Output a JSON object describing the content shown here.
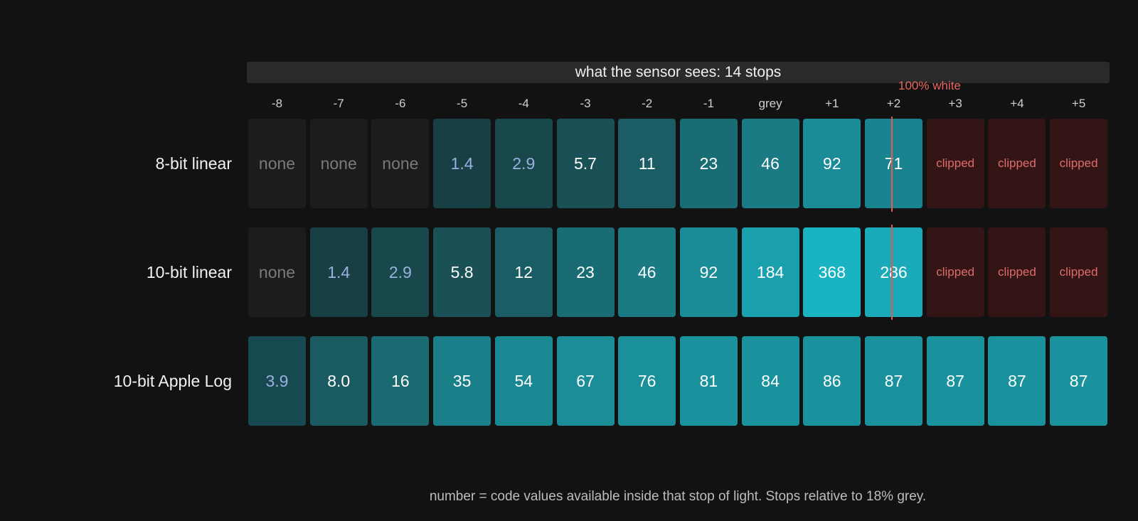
{
  "title": "what the sensor sees: 14 stops",
  "white_label": "100% white",
  "footnote": "number = code values available inside that stop of light. Stops relative to 18% grey.",
  "stops": [
    "-8",
    "-7",
    "-6",
    "-5",
    "-4",
    "-3",
    "-2",
    "-1",
    "grey",
    "+1",
    "+2",
    "+3",
    "+4",
    "+5"
  ],
  "rows": [
    {
      "label": "8-bit linear",
      "cells": [
        {
          "text": "none",
          "kind": "none"
        },
        {
          "text": "none",
          "kind": "none"
        },
        {
          "text": "none",
          "kind": "none"
        },
        {
          "text": "1.4",
          "kind": "dim",
          "color": "#173f44"
        },
        {
          "text": "2.9",
          "kind": "dim",
          "color": "#18474c"
        },
        {
          "text": "5.7",
          "kind": "val",
          "color": "#1a5157"
        },
        {
          "text": "11",
          "kind": "val",
          "color": "#1a5d64"
        },
        {
          "text": "23",
          "kind": "val",
          "color": "#1a6c74"
        },
        {
          "text": "46",
          "kind": "val",
          "color": "#1a7b85"
        },
        {
          "text": "92",
          "kind": "val",
          "color": "#1a8c98"
        },
        {
          "text": "71",
          "kind": "val",
          "color": "#1a8390"
        },
        {
          "text": "clipped",
          "kind": "clipped"
        },
        {
          "text": "clipped",
          "kind": "clipped"
        },
        {
          "text": "clipped",
          "kind": "clipped"
        }
      ]
    },
    {
      "label": "10-bit linear",
      "cells": [
        {
          "text": "none",
          "kind": "none"
        },
        {
          "text": "1.4",
          "kind": "dim",
          "color": "#173f44"
        },
        {
          "text": "2.9",
          "kind": "dim",
          "color": "#18474c"
        },
        {
          "text": "5.8",
          "kind": "val",
          "color": "#1a5157"
        },
        {
          "text": "12",
          "kind": "val",
          "color": "#1a5d64"
        },
        {
          "text": "23",
          "kind": "val",
          "color": "#1a6c74"
        },
        {
          "text": "46",
          "kind": "val",
          "color": "#1a7b85"
        },
        {
          "text": "92",
          "kind": "val",
          "color": "#1a8c98"
        },
        {
          "text": "184",
          "kind": "val",
          "color": "#1aa0ad"
        },
        {
          "text": "368",
          "kind": "val",
          "color": "#1ab3c2"
        },
        {
          "text": "286",
          "kind": "val",
          "color": "#1aaab9"
        },
        {
          "text": "clipped",
          "kind": "clipped"
        },
        {
          "text": "clipped",
          "kind": "clipped"
        },
        {
          "text": "clipped",
          "kind": "clipped"
        }
      ]
    },
    {
      "label": "10-bit Apple Log",
      "cells": [
        {
          "text": "3.9",
          "kind": "dim",
          "color": "#174a50"
        },
        {
          "text": "8.0",
          "kind": "val",
          "color": "#1a5a61"
        },
        {
          "text": "16",
          "kind": "val",
          "color": "#1a6a72"
        },
        {
          "text": "35",
          "kind": "val",
          "color": "#1a7f89"
        },
        {
          "text": "54",
          "kind": "val",
          "color": "#1a8893"
        },
        {
          "text": "67",
          "kind": "val",
          "color": "#1a8d98"
        },
        {
          "text": "76",
          "kind": "val",
          "color": "#1a909b"
        },
        {
          "text": "81",
          "kind": "val",
          "color": "#1a929d"
        },
        {
          "text": "84",
          "kind": "val",
          "color": "#1a929d"
        },
        {
          "text": "86",
          "kind": "val",
          "color": "#1a929d"
        },
        {
          "text": "87",
          "kind": "val",
          "color": "#1a929d"
        },
        {
          "text": "87",
          "kind": "val",
          "color": "#1a929d"
        },
        {
          "text": "87",
          "kind": "val",
          "color": "#1a929d"
        },
        {
          "text": "87",
          "kind": "val",
          "color": "#1a929d"
        }
      ]
    }
  ]
}
